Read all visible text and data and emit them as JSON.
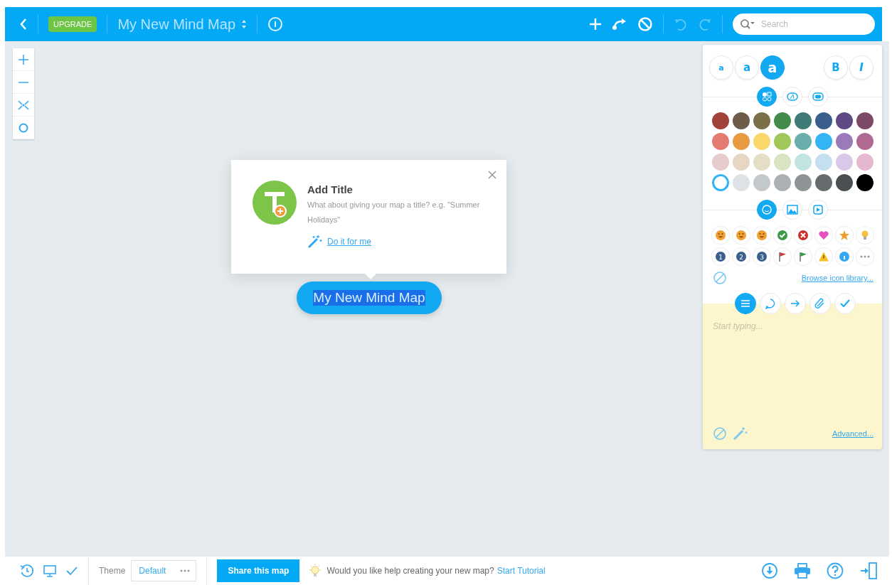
{
  "header": {
    "upgrade": "UPGRADE",
    "title": "My New Mind Map",
    "search": {
      "placeholder": "Search"
    },
    "undo_disabled": true,
    "redo_disabled": true
  },
  "zoom_tools": [
    {
      "kind": "zoom-in"
    },
    {
      "kind": "zoom-out"
    },
    {
      "kind": "fit"
    },
    {
      "kind": "center"
    }
  ],
  "popup": {
    "title": "Add Title",
    "text": "What about giving your map a title? e.g. \"Summer Holidays\"",
    "action": "Do it for me"
  },
  "node": {
    "text": "My New Mind Map",
    "selected": true
  },
  "panel": {
    "font_sizes": [
      {
        "label": "a",
        "selected": false
      },
      {
        "label": "a",
        "selected": false
      },
      {
        "label": "a",
        "selected": true
      }
    ],
    "bold": {
      "label": "B",
      "on": false
    },
    "italic": {
      "label": "I",
      "on": false
    },
    "style_tabs": [
      {
        "kind": "colors",
        "selected": true
      },
      {
        "kind": "shape",
        "selected": false
      },
      {
        "kind": "border",
        "selected": false
      }
    ],
    "colors": [
      {
        "color": "#a0433a",
        "selected": false
      },
      {
        "color": "#6e5c4a",
        "selected": false
      },
      {
        "color": "#7b7049",
        "selected": false
      },
      {
        "color": "#438a4d",
        "selected": false
      },
      {
        "color": "#3f7a77",
        "selected": false
      },
      {
        "color": "#3a5f8c",
        "selected": false
      },
      {
        "color": "#5f4a85",
        "selected": false
      },
      {
        "color": "#7b4a66",
        "selected": false
      },
      {
        "color": "#e57a70",
        "selected": false
      },
      {
        "color": "#e89a40",
        "selected": false
      },
      {
        "color": "#fbd86b",
        "selected": false
      },
      {
        "color": "#a1c65a",
        "selected": false
      },
      {
        "color": "#6aaeab",
        "selected": false
      },
      {
        "color": "#33b5f5",
        "selected": false
      },
      {
        "color": "#9a7ab8",
        "selected": false
      },
      {
        "color": "#b06a92",
        "selected": false
      },
      {
        "color": "#e6cccc",
        "selected": false
      },
      {
        "color": "#e6d6c4",
        "selected": false
      },
      {
        "color": "#e4dfc4",
        "selected": false
      },
      {
        "color": "#d9e4c4",
        "selected": false
      },
      {
        "color": "#c4e4e3",
        "selected": false
      },
      {
        "color": "#c4dff0",
        "selected": false
      },
      {
        "color": "#d9c8e8",
        "selected": false
      },
      {
        "color": "#e6b8cf",
        "selected": false
      },
      {
        "color": "#ffffff",
        "selected": true
      },
      {
        "color": "#dde2e6",
        "selected": false
      },
      {
        "color": "#c4c9cc",
        "selected": false
      },
      {
        "color": "#aab0b3",
        "selected": false
      },
      {
        "color": "#8e9396",
        "selected": false
      },
      {
        "color": "#666b6d",
        "selected": false
      },
      {
        "color": "#4a4f51",
        "selected": false
      },
      {
        "color": "#000000",
        "selected": false
      }
    ],
    "media_tabs": [
      {
        "kind": "icons",
        "selected": true
      },
      {
        "kind": "image",
        "selected": false
      },
      {
        "kind": "video",
        "selected": false
      }
    ],
    "icons": [
      {
        "kind": "face",
        "color": "#f0a030"
      },
      {
        "kind": "face",
        "color": "#f0a030"
      },
      {
        "kind": "face",
        "color": "#f0a030"
      },
      {
        "kind": "check",
        "color": "#3a9a4a"
      },
      {
        "kind": "cross",
        "color": "#c8302c"
      },
      {
        "kind": "heart",
        "color": "#e850c0"
      },
      {
        "kind": "star",
        "color": "#f0a030"
      },
      {
        "kind": "bulb",
        "color": "#f5c040"
      },
      {
        "kind": "number",
        "color": "#3a5f8c",
        "label": "1"
      },
      {
        "kind": "number",
        "color": "#3a5f8c",
        "label": "2"
      },
      {
        "kind": "number",
        "color": "#3a5f8c",
        "label": "3"
      },
      {
        "kind": "flag",
        "color": "#c84040"
      },
      {
        "kind": "flag",
        "color": "#3a9a4a"
      },
      {
        "kind": "warning",
        "color": "#f5c020"
      },
      {
        "kind": "info",
        "color": "#33a8f0"
      },
      {
        "kind": "more",
        "color": "#999999"
      }
    ],
    "browse_link": "Browse icon library...",
    "note_tabs": [
      {
        "kind": "note",
        "selected": true
      },
      {
        "kind": "comment",
        "selected": false
      },
      {
        "kind": "link",
        "selected": false
      },
      {
        "kind": "attachment",
        "selected": false
      },
      {
        "kind": "task",
        "selected": false
      }
    ],
    "note": {
      "placeholder": "Start typing..."
    },
    "advanced_link": "Advanced..."
  },
  "footer": {
    "theme_label": "Theme",
    "theme_value": "Default",
    "share": "Share this map",
    "prompt": "Would you like help creating your new map?",
    "tutorial_link": "Start Tutorial"
  }
}
